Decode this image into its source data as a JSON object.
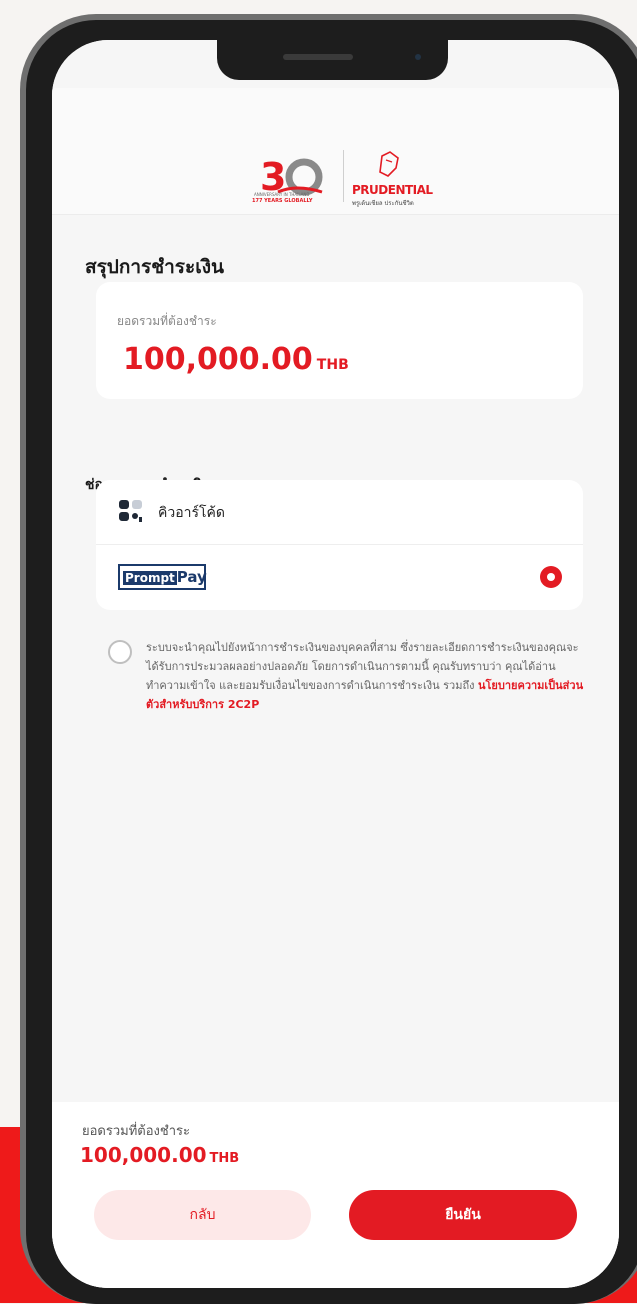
{
  "header": {
    "anniversary_logo": "30",
    "anniversary_years": "177 YEARS GLOBALLY",
    "anniversary_sub": "ANNIVERSARY IN THAILAND",
    "brand_name": "PRUDENTIAL",
    "brand_tagline": "พรูเด้นเชียล ประกันชีวิต"
  },
  "page": {
    "title": "สรุปการชำระเงิน"
  },
  "total_card": {
    "label": "ยอดรวมที่ต้องชำระ",
    "amount": "100,000.00",
    "currency": "THB"
  },
  "payment_channels": {
    "title": "ช่องทางการชำระเงิน",
    "methods": [
      {
        "label": "คิวอาร์โค้ด",
        "icon": "qr-code-icon",
        "selected": false
      },
      {
        "label": "PromptPay",
        "icon": "promptpay-logo",
        "selected": true
      }
    ]
  },
  "consent": {
    "text": "ระบบจะนำคุณไปยังหน้าการชำระเงินของบุคคลที่สาม ซึ่งรายละเอียดการชำระเงินของคุณจะได้รับการประมวลผลอย่างปลอดภัย โดยการดำเนินการตามนี้ คุณรับทราบว่า คุณได้อ่าน ทำความเข้าใจ และยอมรับเงื่อนไขของการดำเนินการชำระเงิน รวมถึง ",
    "link": "นโยบายความเป็นส่วนตัวสำหรับบริการ 2C2P",
    "checked": false
  },
  "footer": {
    "total_label": "ยอดรวมที่ต้องชำระ",
    "amount": "100,000.00",
    "currency": "THB",
    "back_label": "กลับ",
    "confirm_label": "ยืนยัน"
  },
  "colors": {
    "brand_red": "#e31b23",
    "background": "#f6f6f6",
    "back_button_bg": "#fde8e8"
  }
}
